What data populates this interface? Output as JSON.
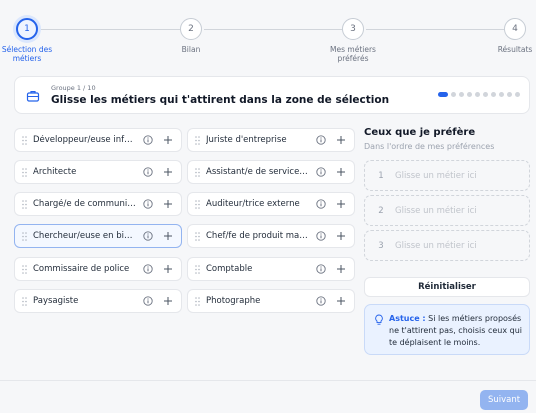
{
  "stepper": {
    "steps": [
      {
        "number": "1",
        "label": "Sélection des métiers"
      },
      {
        "number": "2",
        "label": "Bilan"
      },
      {
        "number": "3",
        "label": "Mes métiers préférés"
      },
      {
        "number": "4",
        "label": "Résultats"
      }
    ],
    "active_step": 1
  },
  "group": {
    "counter": "Groupe 1 / 10",
    "title": "Glisse les métiers qui t'attirent dans la zone de sélection",
    "current_index": 1,
    "total": 10
  },
  "jobs": {
    "left": [
      "Développeur/euse informatique",
      "Architecte",
      "Chargé/e de communication",
      "Chercheur/euse en biologie",
      "Commissaire de police",
      "Paysagiste"
    ],
    "right": [
      "Juriste d'entreprise",
      "Assistant/e de service social",
      "Auditeur/trice externe",
      "Chef/fe de produit marketing",
      "Comptable",
      "Photographe"
    ],
    "highlighted": "Chercheur/euse en biologie"
  },
  "preferences": {
    "title": "Ceux que je préfère",
    "subtitle": "Dans l'ordre de mes préférences",
    "slots": [
      {
        "number": "1",
        "placeholder": "Glisse un métier ici"
      },
      {
        "number": "2",
        "placeholder": "Glisse un métier ici"
      },
      {
        "number": "3",
        "placeholder": "Glisse un métier ici"
      }
    ],
    "reset_label": "Réinitialiser"
  },
  "tip": {
    "label": "Astuce :",
    "text": "Si les métiers proposés ne t'attirent pas, choisis ceux qui te déplaisent le moins."
  },
  "footer": {
    "next_label": "Suivant"
  },
  "colors": {
    "accent": "#2563eb",
    "next_disabled": "#93b4f0",
    "tip_bg": "#eaf2ff"
  }
}
